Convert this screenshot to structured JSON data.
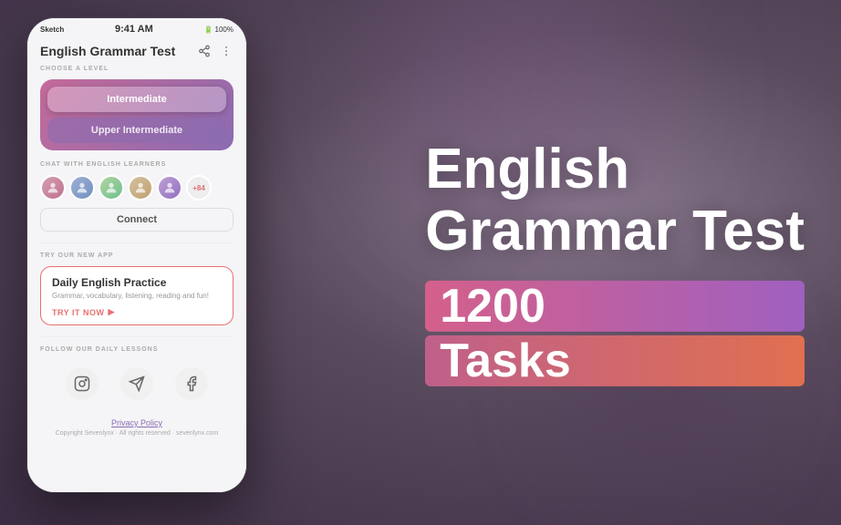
{
  "background": {
    "color1": "#6b5a6e",
    "color2": "#3d2e45"
  },
  "phone": {
    "status_bar": {
      "carrier": "Sketch",
      "time": "9:41 AM",
      "battery": "100%"
    },
    "header": {
      "title": "English Grammar Test",
      "share_icon": "share",
      "menu_icon": "more"
    },
    "level_section": {
      "label": "CHOOSE A LEVEL",
      "buttons": [
        {
          "text": "Intermediate",
          "active": true
        },
        {
          "text": "Upper Intermediate",
          "active": false
        }
      ]
    },
    "chat_section": {
      "label": "CHAT WITH ENGLISH LEARNERS",
      "count_label": "+84",
      "connect_button": "Connect"
    },
    "new_app_section": {
      "label": "TRY OUR NEW APP",
      "card_title": "Daily English Practice",
      "card_desc": "Grammar, vocabulary, listening, reading and fun!",
      "try_button": "TRY IT NOW"
    },
    "social_section": {
      "label": "FOLLOW OUR DAILY LESSONS",
      "icons": [
        "instagram",
        "telegram",
        "facebook"
      ]
    },
    "footer": {
      "privacy_link": "Privacy Policy",
      "copyright": "Copyright Sevenlynx · All rights reserved · sevenlynx.com"
    }
  },
  "hero": {
    "title_line1": "English",
    "title_line2": "Grammar Test",
    "tasks_number": "1200",
    "tasks_label": "Tasks"
  }
}
